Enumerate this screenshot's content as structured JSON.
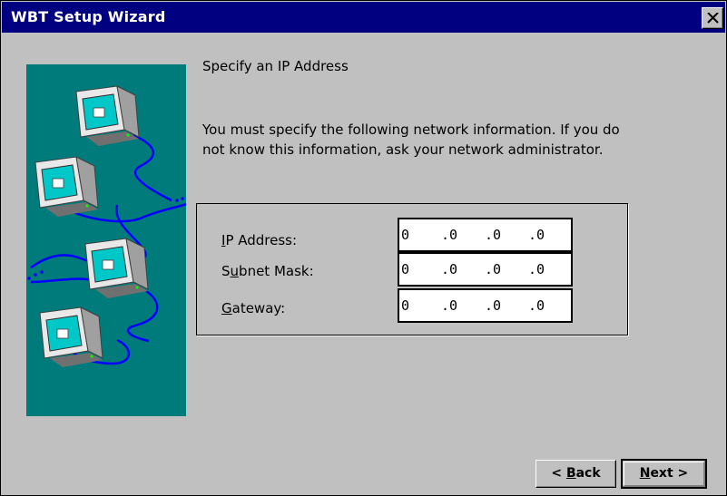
{
  "window": {
    "title": "WBT Setup Wizard",
    "close_icon": "close-icon"
  },
  "page": {
    "heading": "Specify an IP Address",
    "instructions": "You must specify the following network information.  If you do not know this information, ask your network administrator."
  },
  "fields": [
    {
      "label_pre": "",
      "label_mnemonic": "I",
      "label_post": "P Address:",
      "octets": [
        "0",
        ".0",
        ".0",
        ".0"
      ]
    },
    {
      "label_pre": "S",
      "label_mnemonic": "u",
      "label_post": "bnet Mask:",
      "octets": [
        "0",
        ".0",
        ".0",
        ".0"
      ]
    },
    {
      "label_pre": "",
      "label_mnemonic": "G",
      "label_post": "ateway:",
      "octets": [
        "0",
        ".0",
        ".0",
        ".0"
      ]
    }
  ],
  "buttons": {
    "back": {
      "pre": "< ",
      "mnemonic": "B",
      "post": "ack"
    },
    "next": {
      "pre": "",
      "mnemonic": "N",
      "post": "ext >"
    }
  },
  "colors": {
    "titlebar": "#000080",
    "illustration_bg": "#007b7b",
    "face": "#c0c0c0"
  }
}
